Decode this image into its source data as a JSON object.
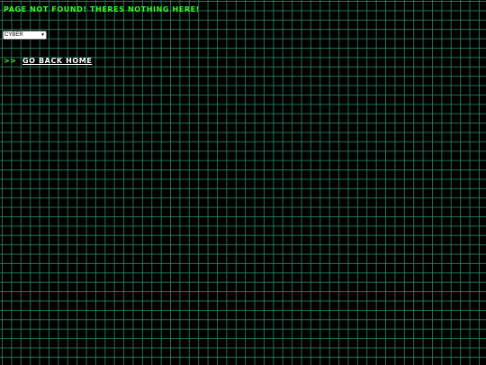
{
  "headline": "PAGE NOT FOUND! THERES NOTHING HERE!",
  "theme_select": {
    "selected": "CYBER",
    "chevron_icon": "chevron-down-icon"
  },
  "back_link": {
    "prefix": ">>",
    "label": "GO BACK HOME"
  },
  "colors": {
    "background": "#000000",
    "grid": "#28966e",
    "accent": "#39ff14",
    "link": "#ffffff"
  }
}
